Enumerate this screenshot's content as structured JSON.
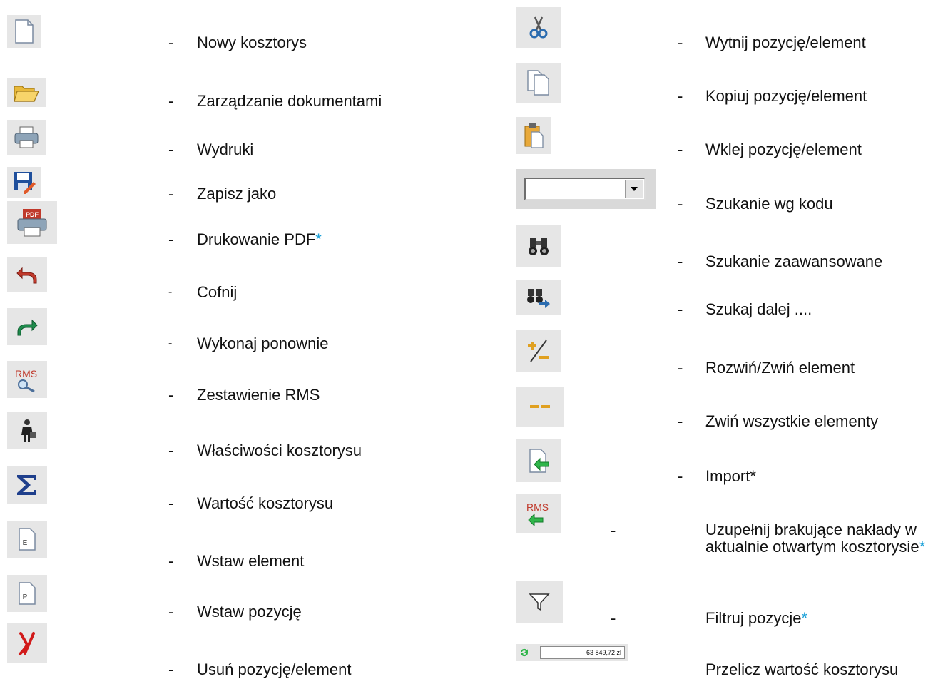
{
  "separator": "-",
  "left_items": [
    {
      "icon": "new-document-icon",
      "label": "Nowy kosztorys",
      "note": ""
    },
    {
      "icon": "open-folder-icon",
      "label": "Zarządzanie dokumentami",
      "note": ""
    },
    {
      "icon": "printer-icon",
      "label": "Wydruki",
      "note": ""
    },
    {
      "icon": "save-as-icon",
      "label": "Zapisz jako",
      "note": ""
    },
    {
      "icon": "pdf-print-icon",
      "label": "Drukowanie PDF",
      "note": "*"
    },
    {
      "icon": "undo-icon",
      "label": "Cofnij",
      "note": ""
    },
    {
      "icon": "redo-icon",
      "label": "Wykonaj ponownie",
      "note": ""
    },
    {
      "icon": "rms-search-icon",
      "label": "Zestawienie RMS",
      "note": ""
    },
    {
      "icon": "properties-person-icon",
      "label": "Właściwości kosztorysu",
      "note": ""
    },
    {
      "icon": "sigma-icon",
      "label": "Wartość kosztorysu",
      "note": ""
    },
    {
      "icon": "insert-element-icon",
      "label": "Wstaw element",
      "note": ""
    },
    {
      "icon": "insert-position-icon",
      "label": "Wstaw pozycję",
      "note": ""
    },
    {
      "icon": "delete-x-icon",
      "label": "Usuń pozycję/element",
      "note": ""
    }
  ],
  "right_items": [
    {
      "icon": "scissors-icon",
      "label": "Wytnij pozycję/element",
      "note": ""
    },
    {
      "icon": "copy-icon",
      "label": "Kopiuj pozycję/element",
      "note": ""
    },
    {
      "icon": "paste-icon",
      "label": "Wklej pozycję/element",
      "note": ""
    },
    {
      "icon": "code-search-combo",
      "label": "Szukanie wg kodu",
      "note": ""
    },
    {
      "icon": "binoculars-icon",
      "label": "Szukanie zaawansowane",
      "note": ""
    },
    {
      "icon": "find-next-icon",
      "label": "Szukaj dalej ....",
      "note": ""
    },
    {
      "icon": "expand-collapse-icon",
      "label": "Rozwiń/Zwiń element",
      "note": ""
    },
    {
      "icon": "collapse-all-icon",
      "label": "Zwiń wszystkie elementy",
      "note": ""
    },
    {
      "icon": "import-icon",
      "label": "Import*",
      "note": ""
    },
    {
      "icon": "rms-import-icon",
      "label": "Uzupełnij brakujące nakłady w aktualnie otwartym kosztorysie",
      "note": "*"
    },
    {
      "icon": "filter-icon",
      "label": "Filtruj pozycje",
      "note": "*"
    },
    {
      "icon": "recalculate-icon",
      "label": "Przelicz wartość kosztorysu",
      "note": ""
    }
  ],
  "icon_text": {
    "pdf": "PDF",
    "rms": "RMS",
    "element_letter": "E",
    "position_letter": "P"
  },
  "recalc_value": "63 849,72 zł",
  "colors": {
    "star": "#1aa0d8",
    "icon_bg": "#e6e6e6",
    "undo_red": "#c0392b",
    "redo_green": "#1e8a4c",
    "delete_red": "#d11a1a"
  }
}
